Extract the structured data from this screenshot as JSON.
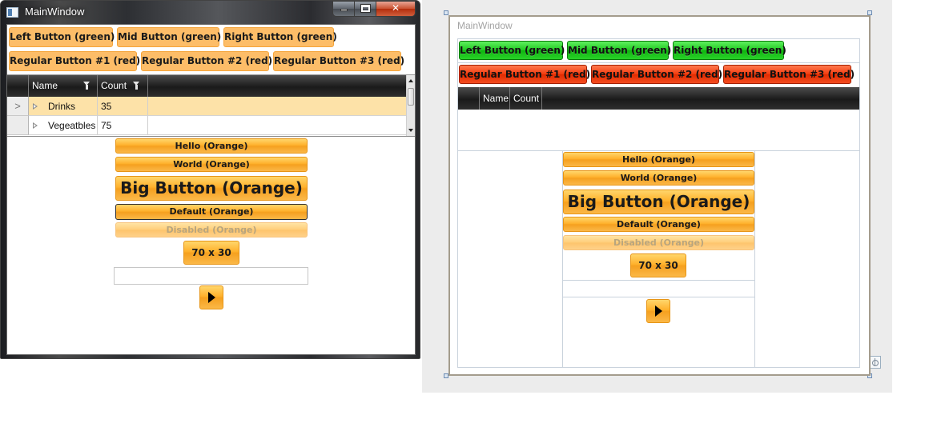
{
  "running_window": {
    "title": "MainWindow",
    "row1": [
      "Left Button (green)",
      "Mid Button (green)",
      "Right Button (green)"
    ],
    "row2": [
      "Regular Button #1 (red)",
      "Regular Button #2 (red)",
      "Regular Button #3 (red)"
    ],
    "grid": {
      "columns": [
        "Name",
        "Count"
      ],
      "rows": [
        {
          "name": "Drinks",
          "count": "35",
          "row_marker": ">"
        },
        {
          "name": "Vegeatbles",
          "count": "75",
          "row_marker": ""
        }
      ]
    },
    "stack": {
      "hello": "Hello (Orange)",
      "world": "World (Orange)",
      "big": "Big Button (Orange)",
      "default": "Default (Orange)",
      "disabled": "Disabled (Orange)",
      "small": "70 x 30",
      "textbox_value": ""
    },
    "caption_buttons": {
      "close_glyph": "✕"
    }
  },
  "designer": {
    "title": "MainWindow",
    "row1": [
      "Left Button (green)",
      "Mid Button (green)",
      "Right Button (green)"
    ],
    "row2": [
      "Regular Button #1 (red)",
      "Regular Button #2 (red)",
      "Regular Button #3 (red)"
    ],
    "grid_columns": [
      "Name",
      "Count"
    ],
    "stack": {
      "hello": "Hello (Orange)",
      "world": "World (Orange)",
      "big": "Big Button (Orange)",
      "default": "Default (Orange)",
      "disabled": "Disabled (Orange)",
      "small": "70 x 30"
    }
  },
  "colors": {
    "orange": "#fdbd68",
    "green": "#1ec81e",
    "red": "#f23a0d",
    "selection": "#fde2a8"
  },
  "icons": [
    "window-app-icon",
    "minimize-icon",
    "maximize-icon",
    "close-icon",
    "filter-icon",
    "expander-icon",
    "play-icon",
    "anchor-icon"
  ]
}
